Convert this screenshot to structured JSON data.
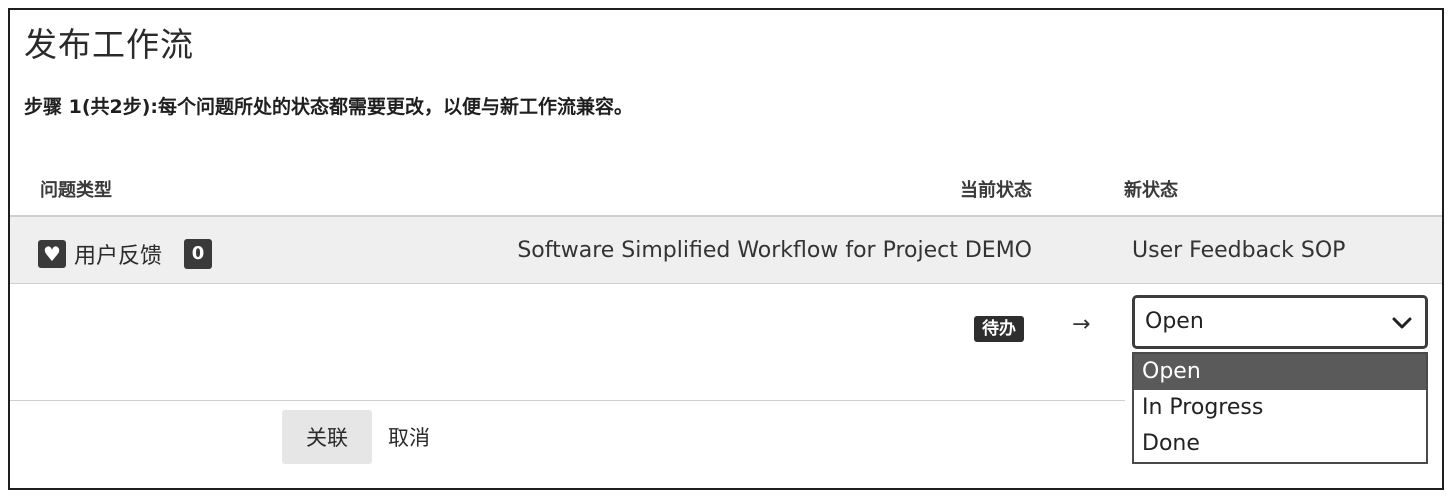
{
  "page_title": "发布工作流",
  "step_text": "步骤 1(共2步):每个问题所处的状态都需要更改，以便与新工作流兼容。",
  "table": {
    "headers": {
      "issue_type": "问题类型",
      "current_status": "当前状态",
      "new_status": "新状态"
    },
    "row": {
      "type_icon": "heart-icon",
      "type_label": "用户反馈",
      "count": "0",
      "current_workflow": "Software Simplified Workflow for Project DEMO",
      "new_workflow": "User Feedback SOP"
    },
    "mapping": {
      "from_status": "待办",
      "arrow": "→",
      "selected": "Open",
      "options": [
        "Open",
        "In Progress",
        "Done"
      ]
    }
  },
  "buttons": {
    "associate": "关联",
    "cancel": "取消"
  },
  "colors": {
    "badge_bg": "#3a3a3a",
    "row_bg": "#efefef",
    "selected_option_bg": "#5a5a5a"
  }
}
